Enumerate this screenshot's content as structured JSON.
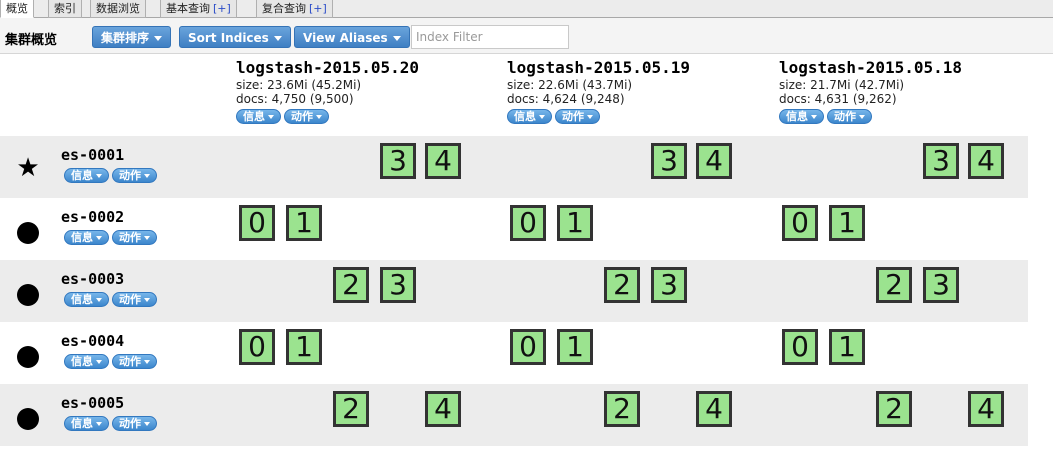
{
  "tabs": [
    {
      "label": "概览",
      "plus": ""
    },
    {
      "label": "索引",
      "plus": ""
    },
    {
      "label": "数据浏览",
      "plus": ""
    },
    {
      "label": "基本查询",
      "plus": "[+]"
    },
    {
      "label": "复合查询",
      "plus": "[+]"
    }
  ],
  "toolbar": {
    "title": "集群概览",
    "cluster_sort": "集群排序",
    "sort_indices": "Sort Indices",
    "view_aliases": "View Aliases",
    "filter_placeholder": "Index Filter"
  },
  "menus": {
    "info": "信息",
    "action": "动作"
  },
  "indices": [
    {
      "name": "logstash-2015.05.20",
      "size": "size: 23.6Mi (45.2Mi)",
      "docs": "docs: 4,750 (9,500)"
    },
    {
      "name": "logstash-2015.05.19",
      "size": "size: 22.6Mi (43.7Mi)",
      "docs": "docs: 4,624 (9,248)"
    },
    {
      "name": "logstash-2015.05.18",
      "size": "size: 21.7Mi (42.7Mi)",
      "docs": "docs: 4,631 (9,262)"
    }
  ],
  "nodes": [
    {
      "name": "es-0001",
      "master": true,
      "marker": "★",
      "shards": [
        [
          "3",
          "4"
        ],
        [
          "3",
          "4"
        ],
        [
          "3",
          "4"
        ]
      ]
    },
    {
      "name": "es-0002",
      "master": false,
      "marker": "●",
      "shards": [
        [
          "0",
          "1"
        ],
        [
          "0",
          "1"
        ],
        [
          "0",
          "1"
        ]
      ]
    },
    {
      "name": "es-0003",
      "master": false,
      "marker": "●",
      "shards": [
        [
          "2",
          "3"
        ],
        [
          "2",
          "3"
        ],
        [
          "2",
          "3"
        ]
      ]
    },
    {
      "name": "es-0004",
      "master": false,
      "marker": "●",
      "shards": [
        [
          "0",
          "1"
        ],
        [
          "0",
          "1"
        ],
        [
          "0",
          "1"
        ]
      ]
    },
    {
      "name": "es-0005",
      "master": false,
      "marker": "●",
      "shards": [
        [
          "2",
          "4"
        ],
        [
          "2",
          "4"
        ],
        [
          "2",
          "4"
        ]
      ]
    }
  ]
}
